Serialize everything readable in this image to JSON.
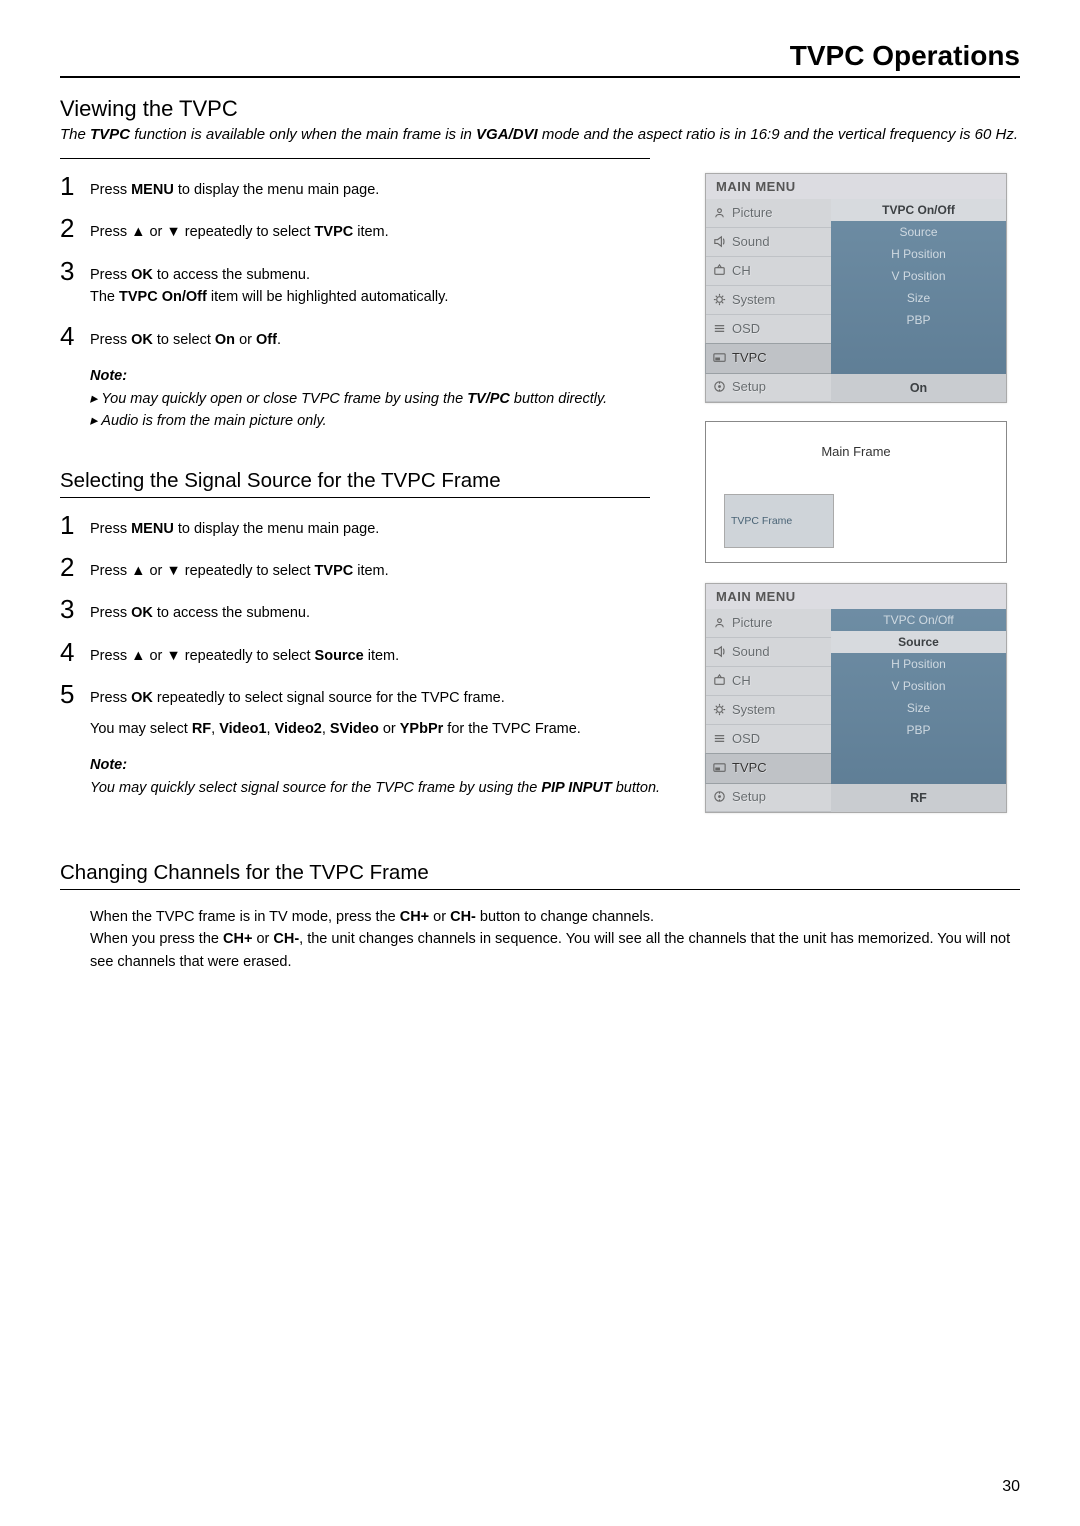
{
  "page_title": "TVPC Operations",
  "page_number": "30",
  "viewing": {
    "heading": "Viewing the TVPC",
    "intro_html": "The <b>TVPC</b> function is available only when the main frame is in <b>VGA/DVI</b> mode and the aspect ratio is in 16:9 and the vertical frequency is 60 Hz.",
    "steps": [
      "Press  <b>MENU</b> to display the menu main page.",
      "Press  ▲ or ▼  repeatedly to select <b>TVPC</b> item.",
      "Press <b>OK</b> to access the submenu.<br>The <b>TVPC On/Off</b>  item will be highlighted automatically.",
      "Press <b>OK</b> to select <b>On</b> or <b>Off</b>."
    ],
    "note_head": "Note:",
    "notes": [
      "You may quickly open or close TVPC  frame by using the <b>TV/PC</b> button directly.",
      "Audio is from the main picture only."
    ]
  },
  "selecting": {
    "heading": "Selecting the Signal Source for the TVPC Frame",
    "steps": [
      "Press  <b>MENU</b> to display the menu main page.",
      "Press  ▲ or ▼  repeatedly to select <b>TVPC</b> item.",
      "Press <b>OK</b> to access the submenu.",
      "Press  ▲ or ▼  repeatedly to select <b>Source</b> item.",
      "Press <b>OK</b> repeatedly to select signal source for the TVPC frame.<br><span style='display:block;margin-top:8px'>You may select <b>RF</b>, <b>Video1</b>, <b>Video2</b>, <b>SVideo</b> or <b>YPbPr</b> for the TVPC Frame.</span>"
    ],
    "note_head": "Note:",
    "note": "You may quickly select signal source for the TVPC frame by using the <b>PIP INPUT</b> button."
  },
  "changing": {
    "heading": "Changing Channels for the TVPC Frame",
    "body_html": "When the TVPC frame is in TV mode, press the <b>CH+</b> or <b>CH-</b>  button to change channels.<br>When you press the <b>CH+</b> or <b>CH-</b>, the unit changes channels in sequence. You will see all the channels that the unit has memorized. You will not see channels that were erased."
  },
  "menu1": {
    "title": "MAIN MENU",
    "left": [
      "Picture",
      "Sound",
      "CH",
      "System",
      "OSD",
      "TVPC",
      "Setup"
    ],
    "right": [
      "TVPC On/Off",
      "Source",
      "H Position",
      "V Position",
      "Size",
      "PBP"
    ],
    "highlight_left": "TVPC",
    "highlight_right": "TVPC On/Off",
    "footer": "On"
  },
  "menu2": {
    "title": "MAIN MENU",
    "left": [
      "Picture",
      "Sound",
      "CH",
      "System",
      "OSD",
      "TVPC",
      "Setup"
    ],
    "right": [
      "TVPC On/Off",
      "Source",
      "H Position",
      "V Position",
      "Size",
      "PBP"
    ],
    "highlight_left": "TVPC",
    "highlight_right": "Source",
    "footer": "RF"
  },
  "frame": {
    "main_label": "Main Frame",
    "inner_label": "TVPC Frame"
  }
}
